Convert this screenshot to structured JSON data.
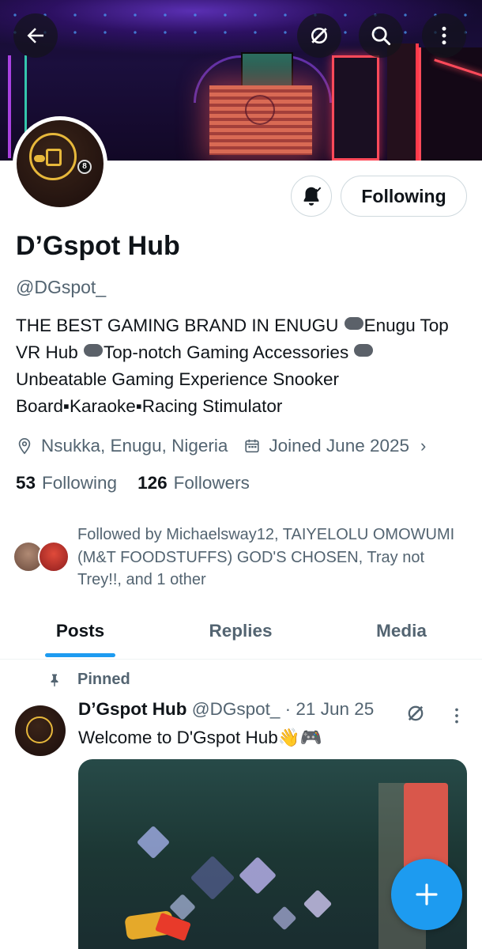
{
  "profile": {
    "display_name": "D’Gspot Hub",
    "handle": "@DGspot_",
    "bio_1": "THE BEST GAMING BRAND IN ENUGU ",
    "bio_2": "Enugu Top VR Hub ",
    "bio_3": "Top-notch Gaming Accessories ",
    "bio_4": "Unbeatable Gaming Experience Snooker Board▪Karaoke▪Racing Stimulator",
    "location": "Nsukka, Enugu, Nigeria",
    "joined": "Joined June 2025"
  },
  "actions": {
    "following_label": "Following"
  },
  "stats": {
    "following_count": "53",
    "following_label": "Following",
    "followers_count": "126",
    "followers_label": "Followers"
  },
  "followed_by": "Followed by Michaelsway12, TAIYELOLU OMOWUMI (M&T FOODSTUFFS) GOD'S CHOSEN, Tray not Trey!!, and 1 other",
  "tabs": [
    {
      "label": "Posts",
      "active": true
    },
    {
      "label": "Replies",
      "active": false
    },
    {
      "label": "Media",
      "active": false
    }
  ],
  "post": {
    "pinned_label": "Pinned",
    "author": "D’Gspot Hub",
    "handle": "@DGspot_",
    "date": "21 Jun 25",
    "text": "Welcome to D'Gspot Hub👋🎮"
  },
  "colors": {
    "accent": "#1d9bf0",
    "text_primary": "#0f1419",
    "text_secondary": "#536471",
    "border": "#cfd9de"
  },
  "icons": {
    "back": "back-arrow-icon",
    "grok": "grok-icon",
    "search": "search-icon",
    "more": "more-vertical-icon",
    "bell": "notification-bell-icon",
    "location": "location-pin-icon",
    "calendar": "calendar-icon",
    "pin": "pin-icon",
    "compose": "plus-icon"
  }
}
